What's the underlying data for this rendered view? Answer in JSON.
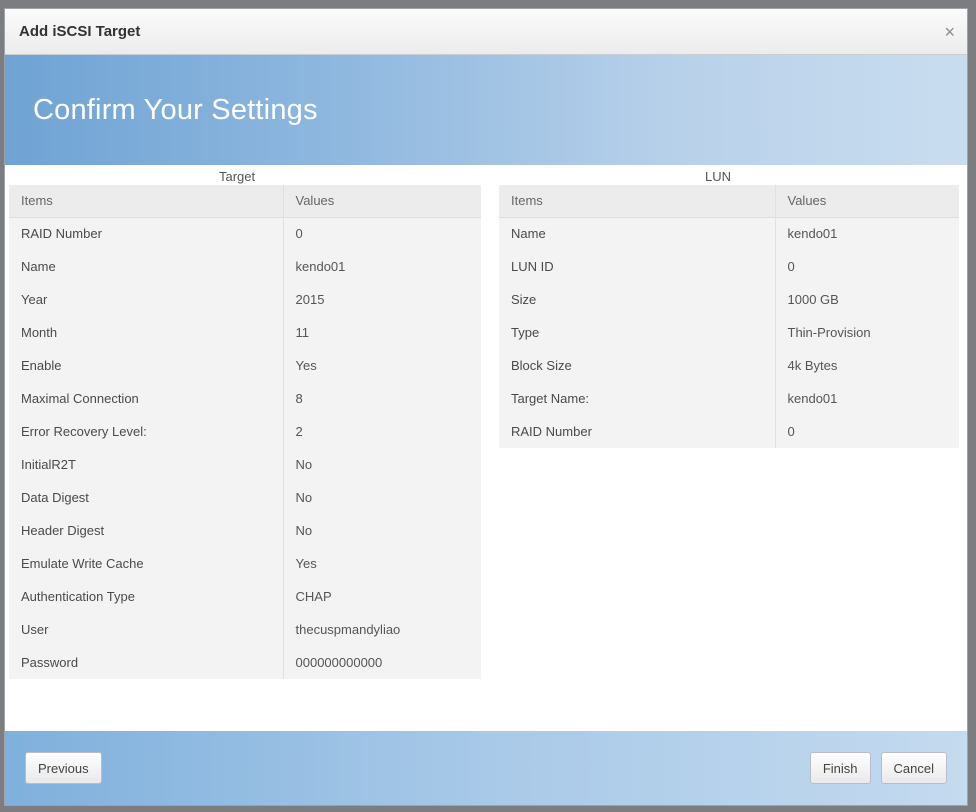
{
  "dialog": {
    "title": "Add iSCSI Target",
    "close_icon": "×",
    "banner_title": "Confirm Your Settings"
  },
  "target": {
    "section_label": "Target",
    "headers": [
      "Items",
      "Values"
    ],
    "rows": [
      [
        "RAID Number",
        "0"
      ],
      [
        "Name",
        "kendo01"
      ],
      [
        "Year",
        "2015"
      ],
      [
        "Month",
        "11"
      ],
      [
        "Enable",
        "Yes"
      ],
      [
        "Maximal Connection",
        "8"
      ],
      [
        "Error Recovery Level:",
        "2"
      ],
      [
        "InitialR2T",
        "No"
      ],
      [
        "Data Digest",
        "No"
      ],
      [
        "Header Digest",
        "No"
      ],
      [
        "Emulate Write Cache",
        "Yes"
      ],
      [
        "Authentication Type",
        "CHAP"
      ],
      [
        "User",
        "thecuspmandyliao"
      ],
      [
        "Password",
        "000000000000"
      ]
    ]
  },
  "lun": {
    "section_label": "LUN",
    "headers": [
      "Items",
      "Values"
    ],
    "rows": [
      [
        "Name",
        "kendo01"
      ],
      [
        "LUN ID",
        "0"
      ],
      [
        "Size",
        "1000 GB"
      ],
      [
        "Type",
        "Thin-Provision"
      ],
      [
        "Block Size",
        "4k Bytes"
      ],
      [
        "Target Name:",
        "kendo01"
      ],
      [
        "RAID Number",
        "0"
      ]
    ]
  },
  "footer": {
    "previous_label": "Previous",
    "finish_label": "Finish",
    "cancel_label": "Cancel"
  },
  "colors": {
    "banner_start": "#6fa3d4",
    "banner_end": "#c9ddef",
    "table_bg": "#f3f3f3"
  }
}
